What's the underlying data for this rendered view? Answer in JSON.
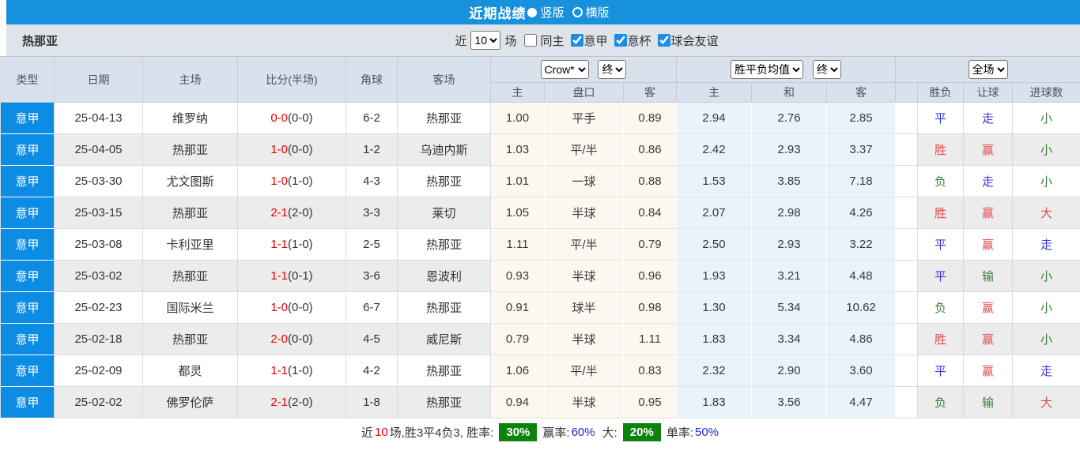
{
  "topbar": {
    "title": "近期战绩",
    "vertical_label": "竖版",
    "horizontal_label": "横版"
  },
  "filterbar": {
    "team": "热那亚",
    "recent_label": "近",
    "recent_value": "10",
    "matches_label": "场",
    "same_home_label": "同主",
    "league_filters": [
      {
        "label": "意甲",
        "checked": true
      },
      {
        "label": "意杯",
        "checked": true
      },
      {
        "label": "球会友谊",
        "checked": true
      }
    ]
  },
  "table": {
    "headers": {
      "type": "类型",
      "date": "日期",
      "home": "主场",
      "score": "比分(半场)",
      "corner": "角球",
      "away": "客场",
      "h_home": "主",
      "handicap": "盘口",
      "h_away": "客",
      "o_home": "主",
      "o_draw": "和",
      "o_away": "客",
      "result": "胜负",
      "handicap_result": "让球",
      "goal_result": "进球数"
    },
    "selects": {
      "company": "Crow*",
      "company_time": "终",
      "avg": "胜平负均值",
      "avg_time": "终",
      "scope": "全场"
    },
    "rows": [
      {
        "league": "意甲",
        "date": "25-04-13",
        "home": "维罗纳",
        "home_focus": false,
        "score_ft": "0-0",
        "score_ht": "(0-0)",
        "corner": "6-2",
        "away": "热那亚",
        "away_focus": true,
        "h_home": "1.00",
        "handicap": "平手",
        "h_away": "0.89",
        "o_home": "2.94",
        "o_draw": "2.76",
        "o_away": "2.85",
        "result": {
          "t": "平",
          "c": "blue"
        },
        "handicap_result": {
          "t": "走",
          "c": "blue"
        },
        "goal_result": {
          "t": "小",
          "c": "green"
        }
      },
      {
        "league": "意甲",
        "date": "25-04-05",
        "home": "热那亚",
        "home_focus": true,
        "score_ft": "1-0",
        "score_ht": "(0-0)",
        "corner": "1-2",
        "away": "乌迪内斯",
        "away_focus": false,
        "h_home": "1.03",
        "handicap": "平/半",
        "h_away": "0.86",
        "o_home": "2.42",
        "o_draw": "2.93",
        "o_away": "3.37",
        "result": {
          "t": "胜",
          "c": "red"
        },
        "handicap_result": {
          "t": "赢",
          "c": "red"
        },
        "goal_result": {
          "t": "小",
          "c": "green"
        }
      },
      {
        "league": "意甲",
        "date": "25-03-30",
        "home": "尤文图斯",
        "home_focus": false,
        "score_ft": "1-0",
        "score_ht": "(1-0)",
        "corner": "4-3",
        "away": "热那亚",
        "away_focus": true,
        "h_home": "1.01",
        "handicap": "一球",
        "h_away": "0.88",
        "o_home": "1.53",
        "o_draw": "3.85",
        "o_away": "7.18",
        "result": {
          "t": "负",
          "c": "green"
        },
        "handicap_result": {
          "t": "走",
          "c": "blue"
        },
        "goal_result": {
          "t": "小",
          "c": "green"
        }
      },
      {
        "league": "意甲",
        "date": "25-03-15",
        "home": "热那亚",
        "home_focus": true,
        "score_ft": "2-1",
        "score_ht": "(2-0)",
        "corner": "3-3",
        "away": "莱切",
        "away_focus": false,
        "h_home": "1.05",
        "handicap": "半球",
        "h_away": "0.84",
        "o_home": "2.07",
        "o_draw": "2.98",
        "o_away": "4.26",
        "result": {
          "t": "胜",
          "c": "red"
        },
        "handicap_result": {
          "t": "赢",
          "c": "red"
        },
        "goal_result": {
          "t": "大",
          "c": "red"
        }
      },
      {
        "league": "意甲",
        "date": "25-03-08",
        "home": "卡利亚里",
        "home_focus": false,
        "score_ft": "1-1",
        "score_ht": "(1-0)",
        "corner": "2-5",
        "away": "热那亚",
        "away_focus": true,
        "h_home": "1.11",
        "handicap": "平/半",
        "h_away": "0.79",
        "o_home": "2.50",
        "o_draw": "2.93",
        "o_away": "3.22",
        "result": {
          "t": "平",
          "c": "blue"
        },
        "handicap_result": {
          "t": "赢",
          "c": "red"
        },
        "goal_result": {
          "t": "走",
          "c": "blue"
        }
      },
      {
        "league": "意甲",
        "date": "25-03-02",
        "home": "热那亚",
        "home_focus": true,
        "score_ft": "1-1",
        "score_ht": "(0-1)",
        "corner": "3-6",
        "away": "恩波利",
        "away_focus": false,
        "h_home": "0.93",
        "handicap": "半球",
        "h_away": "0.96",
        "o_home": "1.93",
        "o_draw": "3.21",
        "o_away": "4.48",
        "result": {
          "t": "平",
          "c": "blue"
        },
        "handicap_result": {
          "t": "输",
          "c": "green"
        },
        "goal_result": {
          "t": "小",
          "c": "green"
        }
      },
      {
        "league": "意甲",
        "date": "25-02-23",
        "home": "国际米兰",
        "home_focus": false,
        "score_ft": "1-0",
        "score_ht": "(0-0)",
        "corner": "6-7",
        "away": "热那亚",
        "away_focus": true,
        "h_home": "0.91",
        "handicap": "球半",
        "h_away": "0.98",
        "o_home": "1.30",
        "o_draw": "5.34",
        "o_away": "10.62",
        "result": {
          "t": "负",
          "c": "green"
        },
        "handicap_result": {
          "t": "赢",
          "c": "red"
        },
        "goal_result": {
          "t": "小",
          "c": "green"
        }
      },
      {
        "league": "意甲",
        "date": "25-02-18",
        "home": "热那亚",
        "home_focus": true,
        "score_ft": "2-0",
        "score_ht": "(0-0)",
        "corner": "4-5",
        "away": "威尼斯",
        "away_focus": false,
        "h_home": "0.79",
        "handicap": "半球",
        "h_away": "1.11",
        "o_home": "1.83",
        "o_draw": "3.34",
        "o_away": "4.86",
        "result": {
          "t": "胜",
          "c": "red"
        },
        "handicap_result": {
          "t": "赢",
          "c": "red"
        },
        "goal_result": {
          "t": "小",
          "c": "green"
        }
      },
      {
        "league": "意甲",
        "date": "25-02-09",
        "home": "都灵",
        "home_focus": false,
        "score_ft": "1-1",
        "score_ht": "(1-0)",
        "corner": "4-2",
        "away": "热那亚",
        "away_focus": true,
        "h_home": "1.06",
        "handicap": "平/半",
        "h_away": "0.83",
        "o_home": "2.32",
        "o_draw": "2.90",
        "o_away": "3.60",
        "result": {
          "t": "平",
          "c": "blue"
        },
        "handicap_result": {
          "t": "赢",
          "c": "red"
        },
        "goal_result": {
          "t": "走",
          "c": "blue"
        }
      },
      {
        "league": "意甲",
        "date": "25-02-02",
        "home": "佛罗伦萨",
        "home_focus": false,
        "score_ft": "2-1",
        "score_ht": "(2-0)",
        "corner": "1-8",
        "away": "热那亚",
        "away_focus": true,
        "h_home": "0.94",
        "handicap": "半球",
        "h_away": "0.95",
        "o_home": "1.83",
        "o_draw": "3.56",
        "o_away": "4.47",
        "result": {
          "t": "负",
          "c": "green"
        },
        "handicap_result": {
          "t": "输",
          "c": "green"
        },
        "goal_result": {
          "t": "大",
          "c": "red"
        }
      }
    ]
  },
  "footer": {
    "prefix": "近",
    "count": "10",
    "summary": "场,胜3平4负3, 胜率:",
    "win_rate": "30%",
    "handicap_label": "赢率:",
    "handicap_rate": "60%",
    "big_label": "大:",
    "big_rate": "20%",
    "single_label": "单率:",
    "single_rate": "50%"
  }
}
